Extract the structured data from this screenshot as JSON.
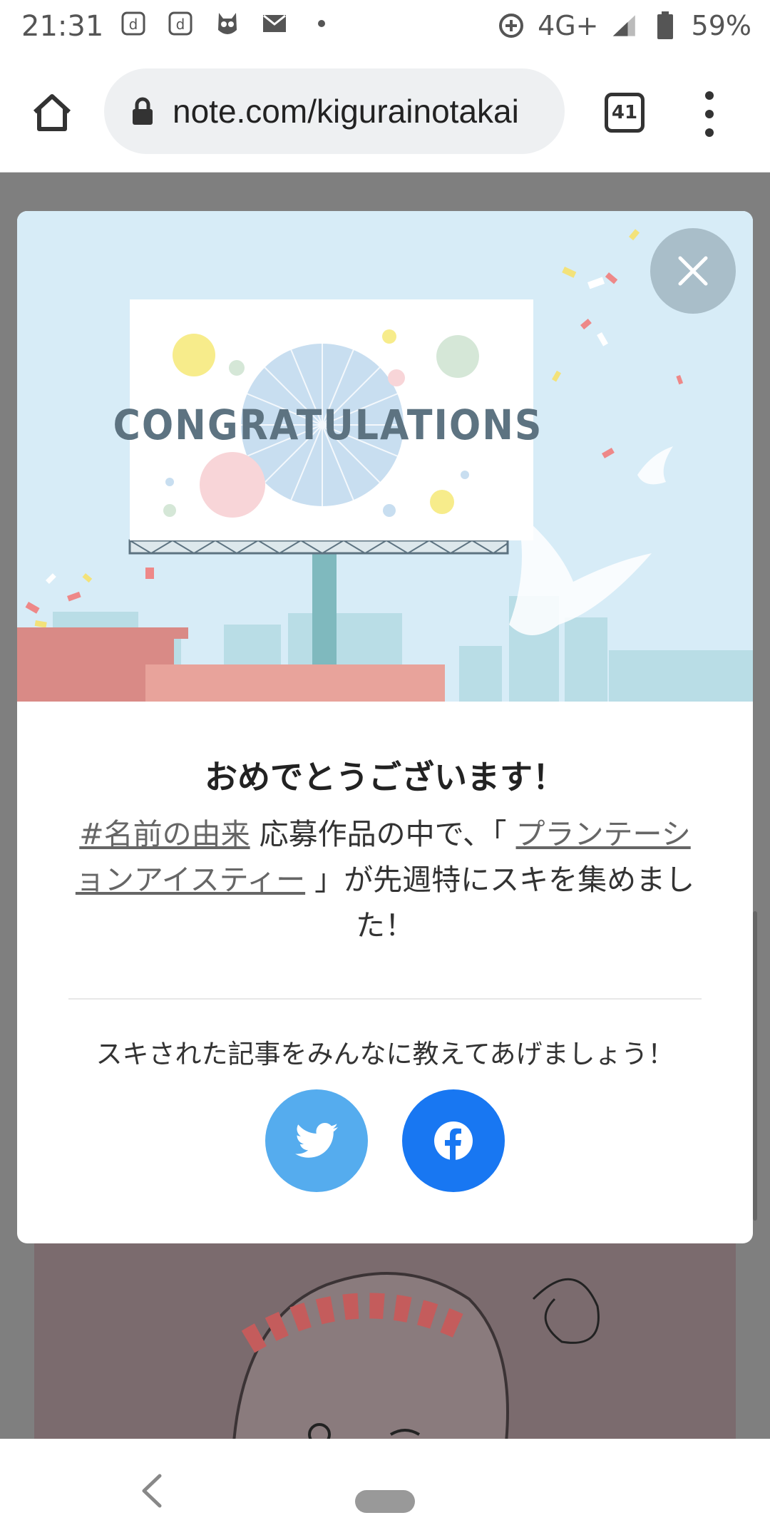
{
  "status_bar": {
    "time": "21:31",
    "network": "4G+",
    "battery": "59%",
    "icons": [
      "d-app-icon",
      "d-app-icon",
      "owl-app-icon",
      "mail-icon",
      "dot-icon",
      "data-saver-icon",
      "signal-icon",
      "battery-icon"
    ]
  },
  "browser": {
    "url": "note.com/kigurainotakai",
    "tab_count": "41"
  },
  "modal": {
    "banner_text": "CONGRATULATIONS",
    "title": "おめでとうございます！",
    "body": {
      "hashtag": "#名前の由来",
      "text1": " 応募作品の中で、「 ",
      "article_title": "プランテーションアイスティー",
      "text2": " 」が先週特にスキを集めました！"
    },
    "share_prompt": "スキされた記事をみんなに教えてあげましょう！",
    "share_buttons": [
      "twitter",
      "facebook"
    ]
  },
  "colors": {
    "twitter": "#55acee",
    "facebook": "#1877f2",
    "sky": "#d7ecf7",
    "close_button": "#a9bec9"
  }
}
